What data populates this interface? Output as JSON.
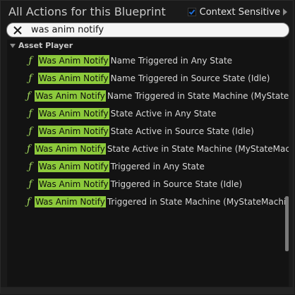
{
  "header": {
    "title": "All Actions for this Blueprint",
    "context_sensitive_label": "Context Sensitive",
    "context_sensitive_checked": true
  },
  "search": {
    "value": "was anim notify",
    "placeholder": ""
  },
  "tree": {
    "category": {
      "label": "Asset Player",
      "expanded": true
    },
    "items": [
      {
        "match": "Was Anim Notify",
        "rest": "Name Triggered in Any State"
      },
      {
        "match": "Was Anim Notify",
        "rest": "Name Triggered in Source State (Idle)"
      },
      {
        "match": "Was Anim Notify",
        "rest": "Name Triggered in State Machine (MyStateM"
      },
      {
        "match": "Was Anim Notify",
        "rest": "State Active in Any State"
      },
      {
        "match": "Was Anim Notify",
        "rest": "State Active in Source State (Idle)"
      },
      {
        "match": "Was Anim Notify",
        "rest": "State Active in State Machine (MyStateMachi"
      },
      {
        "match": "Was Anim Notify",
        "rest": "Triggered in Any State"
      },
      {
        "match": "Was Anim Notify",
        "rest": "Triggered in Source State (Idle)"
      },
      {
        "match": "Was Anim Notify",
        "rest": "Triggered in State Machine (MyStateMachine"
      }
    ],
    "item_icon": "function-icon",
    "highlight_color": "#8dca3c",
    "icon_color": "#9fd65a"
  },
  "colors": {
    "background": "#1a1a1a",
    "list_background": "#131313",
    "checkbox_check": "#1e6fd9"
  }
}
